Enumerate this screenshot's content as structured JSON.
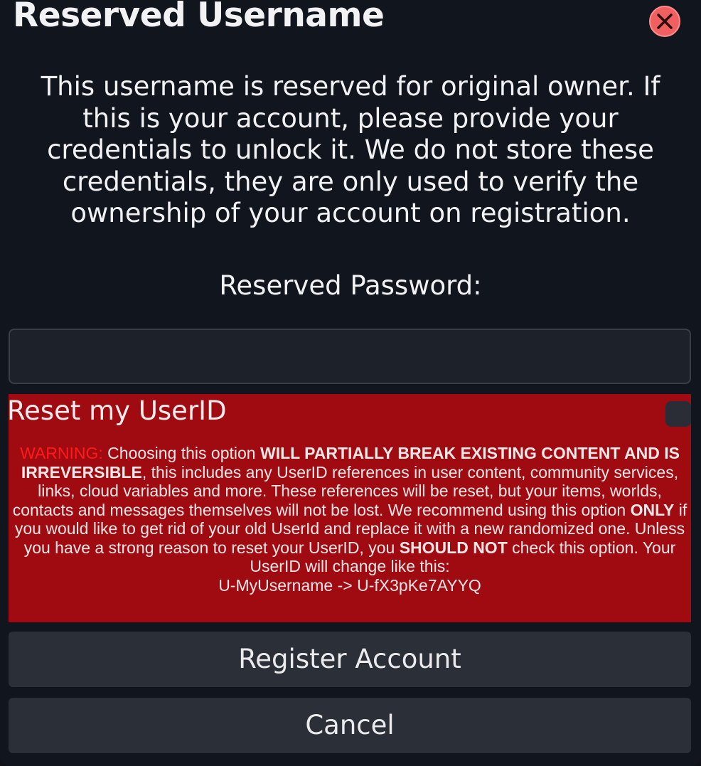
{
  "dialog": {
    "title": "Reserved Username",
    "intro_text": "This username is reserved for original owner. If this is your account, please provide your credentials to unlock it. We do not store these credentials, they are only used to verify the ownership of your account on registration.",
    "password_label": "Reserved Password:",
    "password_value": "",
    "close_icon": "close-icon",
    "colors": {
      "background": "#11151d",
      "warning_panel": "#a00b12",
      "warning_tag": "#ff1a1a",
      "close_button": "#f06060"
    }
  },
  "reset": {
    "label": "Reset my UserID",
    "checked": false,
    "warning": {
      "tag": "WARNING:",
      "p1": " Choosing this option ",
      "b1": "WILL PARTIALLY BREAK EXISTING CONTENT AND IS IRREVERSIBLE",
      "p2": ", this includes any UserID references in user content, community services, links, cloud variables and more. These references will be reset, but your items, worlds, contacts and messages themselves will not be lost. We recommend using this option ",
      "b2": "ONLY",
      "p3": " if you would like to get rid of your old UserId and replace it with a new randomized one. Unless you have a strong reason to reset your UserID, you ",
      "b3": "SHOULD NOT",
      "p4": " check this option. Your UserID will change like this:",
      "example": "U-MyUsername -> U-fX3pKe7AYYQ"
    }
  },
  "buttons": {
    "register": "Register Account",
    "cancel": "Cancel"
  }
}
